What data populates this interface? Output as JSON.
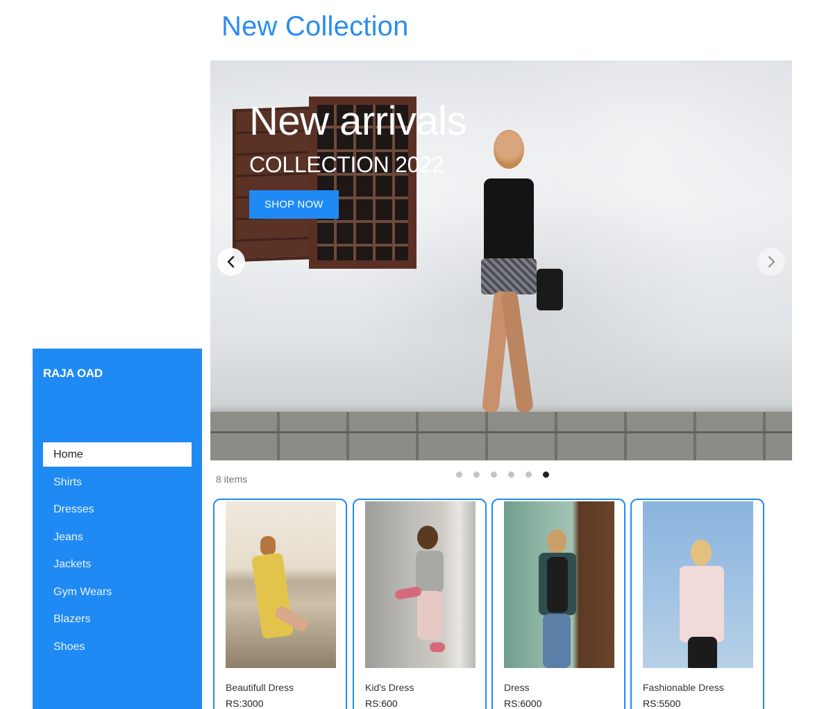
{
  "page": {
    "title": "New Collection"
  },
  "carousel": {
    "title": "New arrivals",
    "subtitle": "COLLECTION 2022",
    "button_label": "SHOP NOW",
    "prev_icon": "chevron-left-icon",
    "next_icon": "chevron-right-icon",
    "slide_count": 6,
    "active_slide": 6
  },
  "items_count": "8 items",
  "sidebar": {
    "brand": "RAJA OAD",
    "items": [
      {
        "label": "Home",
        "active": true
      },
      {
        "label": "Shirts",
        "active": false
      },
      {
        "label": "Dresses",
        "active": false
      },
      {
        "label": "Jeans",
        "active": false
      },
      {
        "label": "Jackets",
        "active": false
      },
      {
        "label": "Gym Wears",
        "active": false
      },
      {
        "label": "Blazers",
        "active": false
      },
      {
        "label": "Shoes",
        "active": false
      }
    ]
  },
  "products": [
    {
      "name": "Beautifull Dress",
      "price": "RS:3000"
    },
    {
      "name": "Kid's Dress",
      "price": "RS:600"
    },
    {
      "name": "Dress",
      "price": "RS:6000"
    },
    {
      "name": "Fashionable Dress",
      "price": "RS:5500"
    }
  ],
  "colors": {
    "accent": "#1f8af3",
    "title": "#2a8cf2"
  }
}
